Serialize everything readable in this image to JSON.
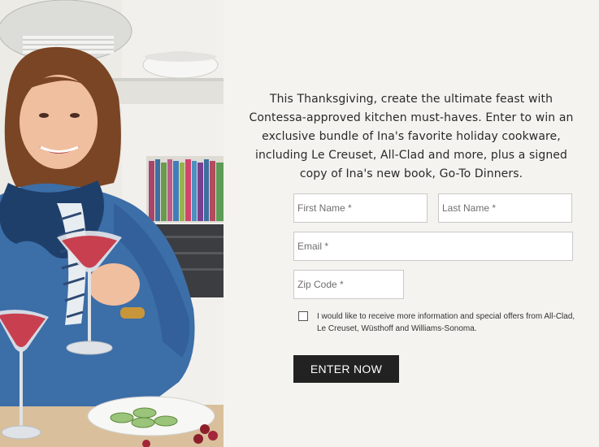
{
  "photo": {
    "alt": "Ina Garten holding a pink cocktail in a kitchen"
  },
  "intro": {
    "text": "This Thanksgiving, create the ultimate feast with Contessa-approved kitchen must-haves. Enter to win an exclusive bundle of Ina's favorite holiday cookware, including Le Creuset, All-Clad and more, plus a signed copy of Ina's new book, Go-To Dinners."
  },
  "form": {
    "first_name_placeholder": "First Name *",
    "last_name_placeholder": "Last Name *",
    "email_placeholder": "Email *",
    "zip_placeholder": "Zip Code *",
    "optin_label": "I would like to receive more information and special offers from All-Clad, Le Creuset, Wüsthoff and Williams-Sonoma.",
    "optin_checked": false,
    "submit_label": "ENTER NOW"
  },
  "colors": {
    "panel_background": "#f4f3ef",
    "button_background": "#222222",
    "button_text": "#ffffff",
    "field_border": "#c9c9c9"
  }
}
